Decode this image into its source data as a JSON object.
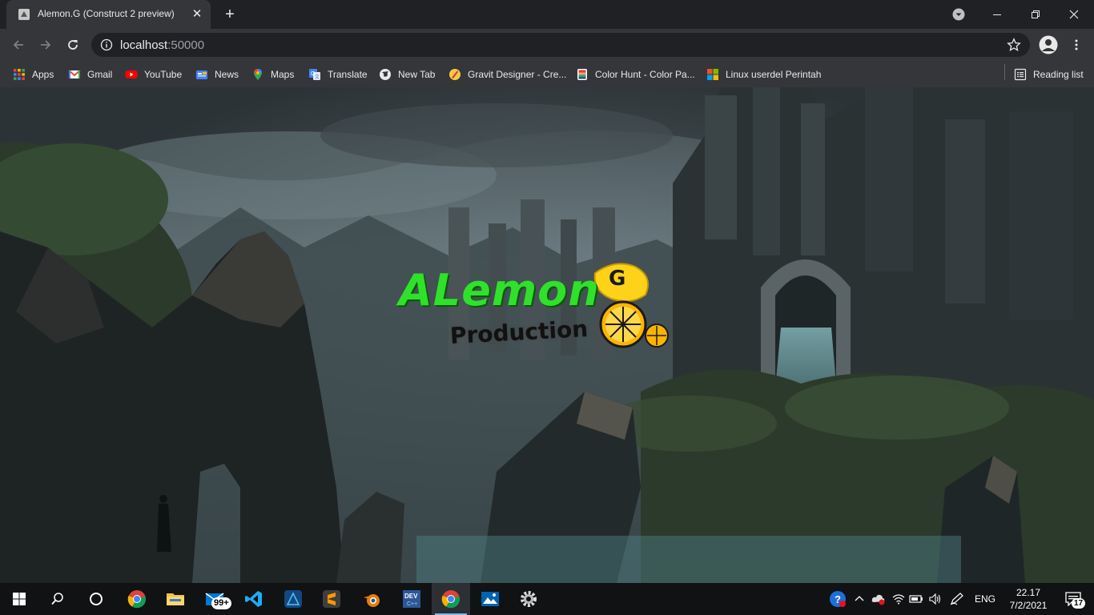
{
  "browser": {
    "tab": {
      "title": "Alemon.G (Construct 2 preview)",
      "close": "✕"
    },
    "new_tab": "+",
    "address": {
      "host": "localhost",
      "port": ":50000"
    },
    "bookmarks": [
      {
        "label": "Apps",
        "icon": "apps-grid-icon"
      },
      {
        "label": "Gmail",
        "icon": "gmail-icon"
      },
      {
        "label": "YouTube",
        "icon": "youtube-icon"
      },
      {
        "label": "News",
        "icon": "news-icon"
      },
      {
        "label": "Maps",
        "icon": "maps-icon"
      },
      {
        "label": "Translate",
        "icon": "translate-icon"
      },
      {
        "label": "New Tab",
        "icon": "globe-icon"
      },
      {
        "label": "Gravit Designer - Cre...",
        "icon": "gravit-icon"
      },
      {
        "label": "Color Hunt - Color Pa...",
        "icon": "colorhunt-icon"
      },
      {
        "label": "Linux userdel Perintah",
        "icon": "linux-icon"
      }
    ],
    "reading_list": "Reading list"
  },
  "game": {
    "logo": {
      "title": "ALemon",
      "badge": "G",
      "subtitle": "Production"
    }
  },
  "taskbar": {
    "mail_badge": "99+",
    "language": "ENG",
    "time": "22.17",
    "date": "7/2/2021",
    "notifications": "17",
    "apps": [
      "chrome-icon",
      "file-explorer-icon",
      "mail-icon",
      "vscode-icon",
      "affinity-icon",
      "sublime-icon",
      "blender-icon",
      "devcpp-icon",
      "chrome-icon",
      "photos-icon",
      "settings-icon"
    ]
  },
  "colors": {
    "logo_green": "#2fe12a",
    "lemon_yellow": "#ffd21a",
    "chrome_dark": "#202124",
    "chrome_toolbar": "#35363a",
    "taskbar": "#101214"
  }
}
